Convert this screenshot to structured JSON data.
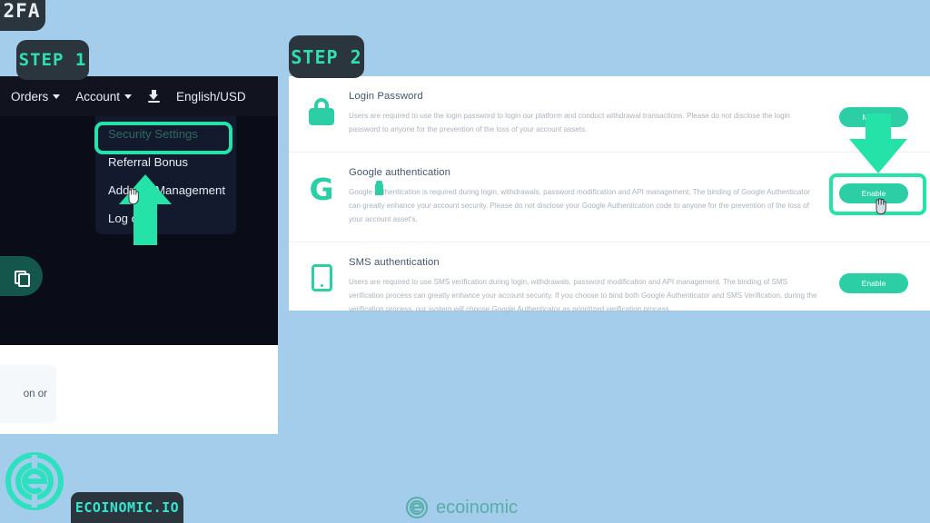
{
  "badges": {
    "topic": "2FA",
    "step1": "STEP 1",
    "step2": "STEP 2"
  },
  "colors": {
    "background": "#a3cdeb",
    "accent_teal": "#2ccfa5",
    "highlight_green": "#25e3a8",
    "badge_dark": "#2b353d",
    "nav_dark": "#11141f",
    "dropdown_dark": "#141a2e"
  },
  "left_panel": {
    "navbar": {
      "items": [
        {
          "label": "Orders",
          "has_caret": true
        },
        {
          "label": "Account",
          "has_caret": true
        }
      ],
      "download_icon": "download-icon",
      "locale": "English/USD"
    },
    "dropdown": {
      "items": [
        {
          "label": "Security Settings",
          "highlighted": true
        },
        {
          "label": "Referral Bonus",
          "highlighted": false
        },
        {
          "label": "Address Management",
          "highlighted": false
        },
        {
          "label": "Log out",
          "highlighted": false
        }
      ]
    },
    "copy_pill_icon": "copy-icon",
    "card_text": "on or"
  },
  "right_panel": {
    "sections": [
      {
        "icon": "lock-icon",
        "title": "Login Password",
        "description": "Users are required to use the login password to login our platform and conduct withdrawal transactions. Please do not disclose the login password to anyone for the prevention of the loss of your account assets.",
        "action_label": "Modify",
        "highlighted": false
      },
      {
        "icon": "google-g-icon",
        "title": "Google authentication",
        "description": "Google authentication is required during login, withdrawals, password modification and API management. The binding of Google Authenticator can greatly enhance your account security. Please do not disclose your Google Authentication code to anyone for the prevention of the loss of your account asset's.",
        "action_label": "Enable",
        "highlighted": true
      },
      {
        "icon": "phone-icon",
        "title": "SMS authentication",
        "description": "Users are required to use SMS verification during login, withdrawals, password modification and API management. The binding of SMS verification process can greatly enhance your account security. If you choose to bind both Google Authenticator and SMS Verification, during the verification process, our system will choose Google Authenticator as prioritized verification process.",
        "action_label": "Enable",
        "highlighted": false
      }
    ]
  },
  "branding": {
    "logo": "ecoinomic-logo-icon",
    "tag": "ECOINOMIC.IO",
    "watermark": "ecoinomic"
  }
}
